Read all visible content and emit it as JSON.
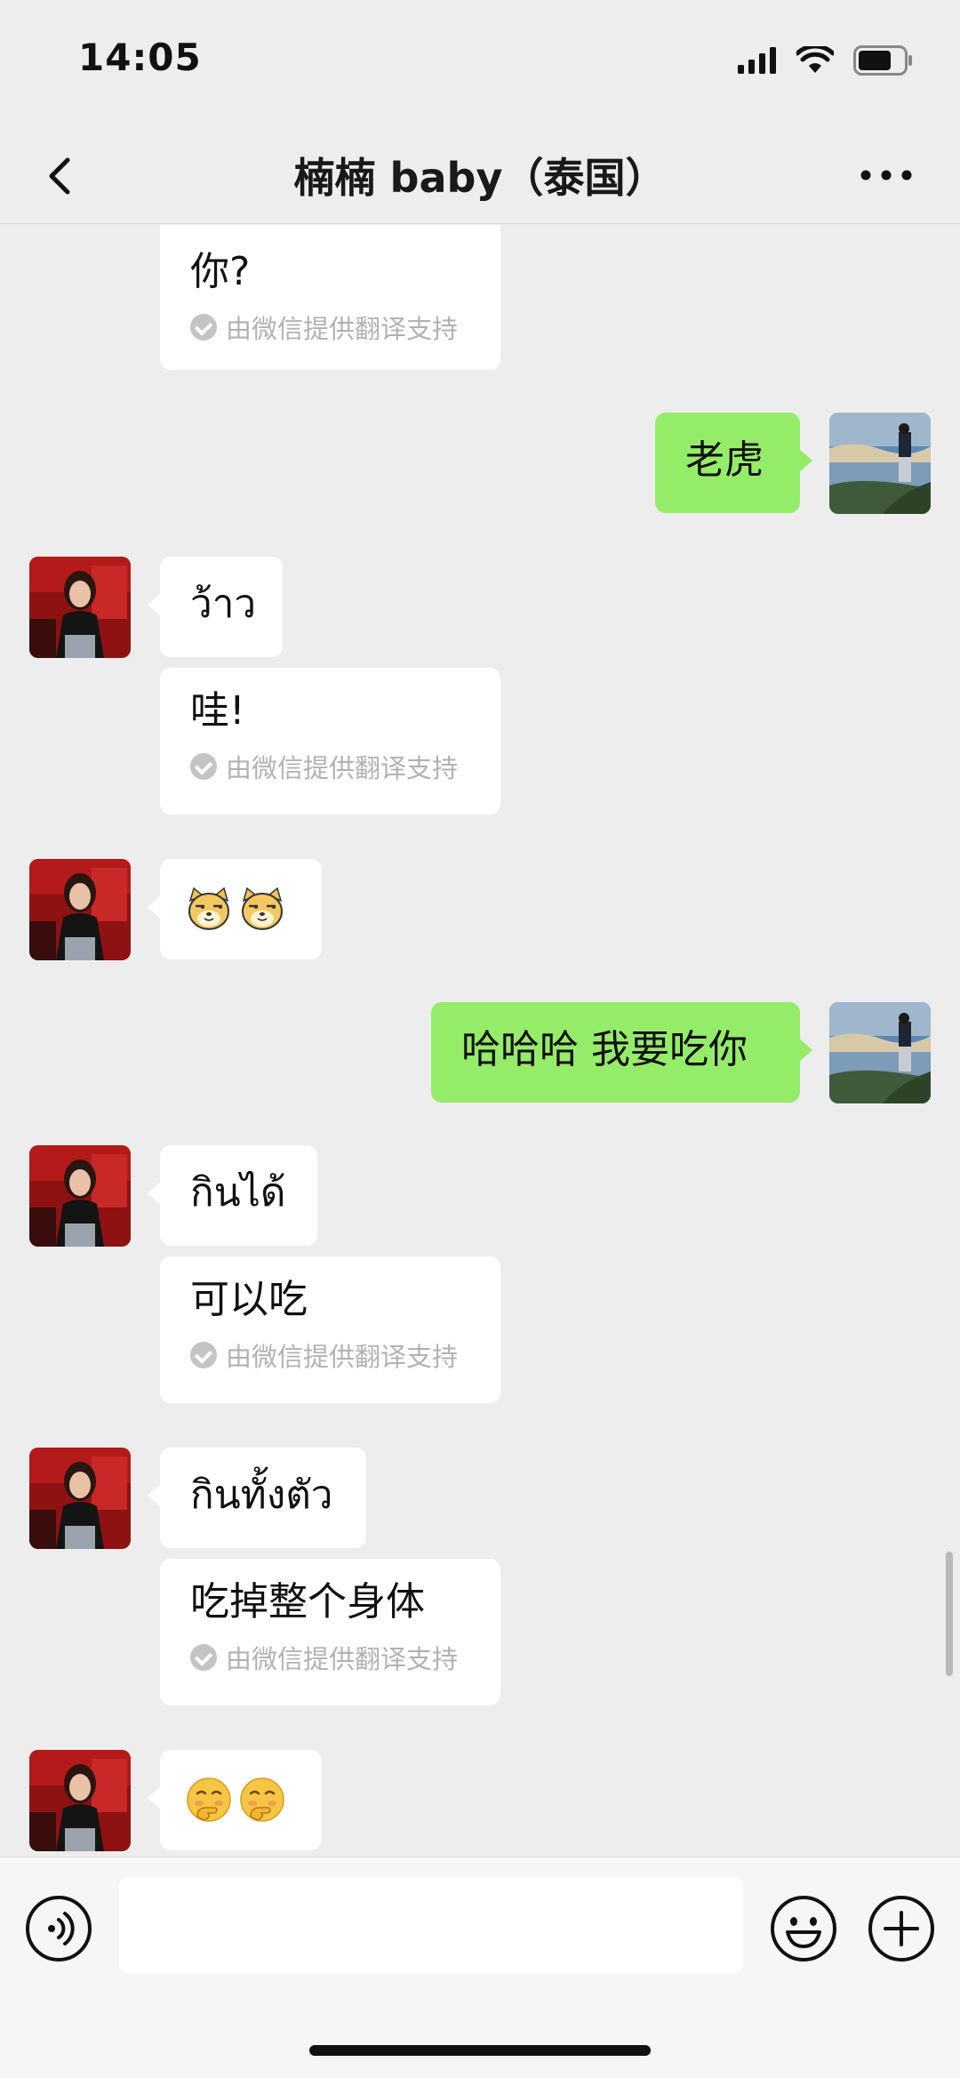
{
  "status_bar": {
    "time": "14:05",
    "icons": [
      "signal-icon",
      "wifi-icon",
      "battery-icon"
    ]
  },
  "nav": {
    "title": "楠楠 baby（泰国）",
    "back_icon": "chevron-left-icon",
    "more_icon": "more-dots-icon"
  },
  "messages": {
    "m0": {
      "text": "你?",
      "note": "由微信提供翻译支持"
    },
    "m1": {
      "text": "老虎"
    },
    "m2": {
      "text": "ว้าว"
    },
    "m3": {
      "text": "哇!",
      "note": "由微信提供翻译支持"
    },
    "m4": {
      "emoji": [
        "doge-emoji",
        "doge-emoji"
      ]
    },
    "m5": {
      "text": "哈哈哈 我要吃你"
    },
    "m6": {
      "text": "กินได้"
    },
    "m7": {
      "text": "可以吃",
      "note": "由微信提供翻译支持"
    },
    "m8": {
      "text": "กินทั้งตัว"
    },
    "m9": {
      "text": "吃掉整个身体",
      "note": "由微信提供翻译支持"
    },
    "m10": {
      "emoji": [
        "thinking-hand-emoji",
        "thinking-hand-emoji"
      ]
    }
  },
  "input_bar": {
    "value": "",
    "placeholder": ""
  },
  "colors": {
    "background": "#ededed",
    "sent_bubble": "#95ec69",
    "received_bubble": "#ffffff"
  }
}
